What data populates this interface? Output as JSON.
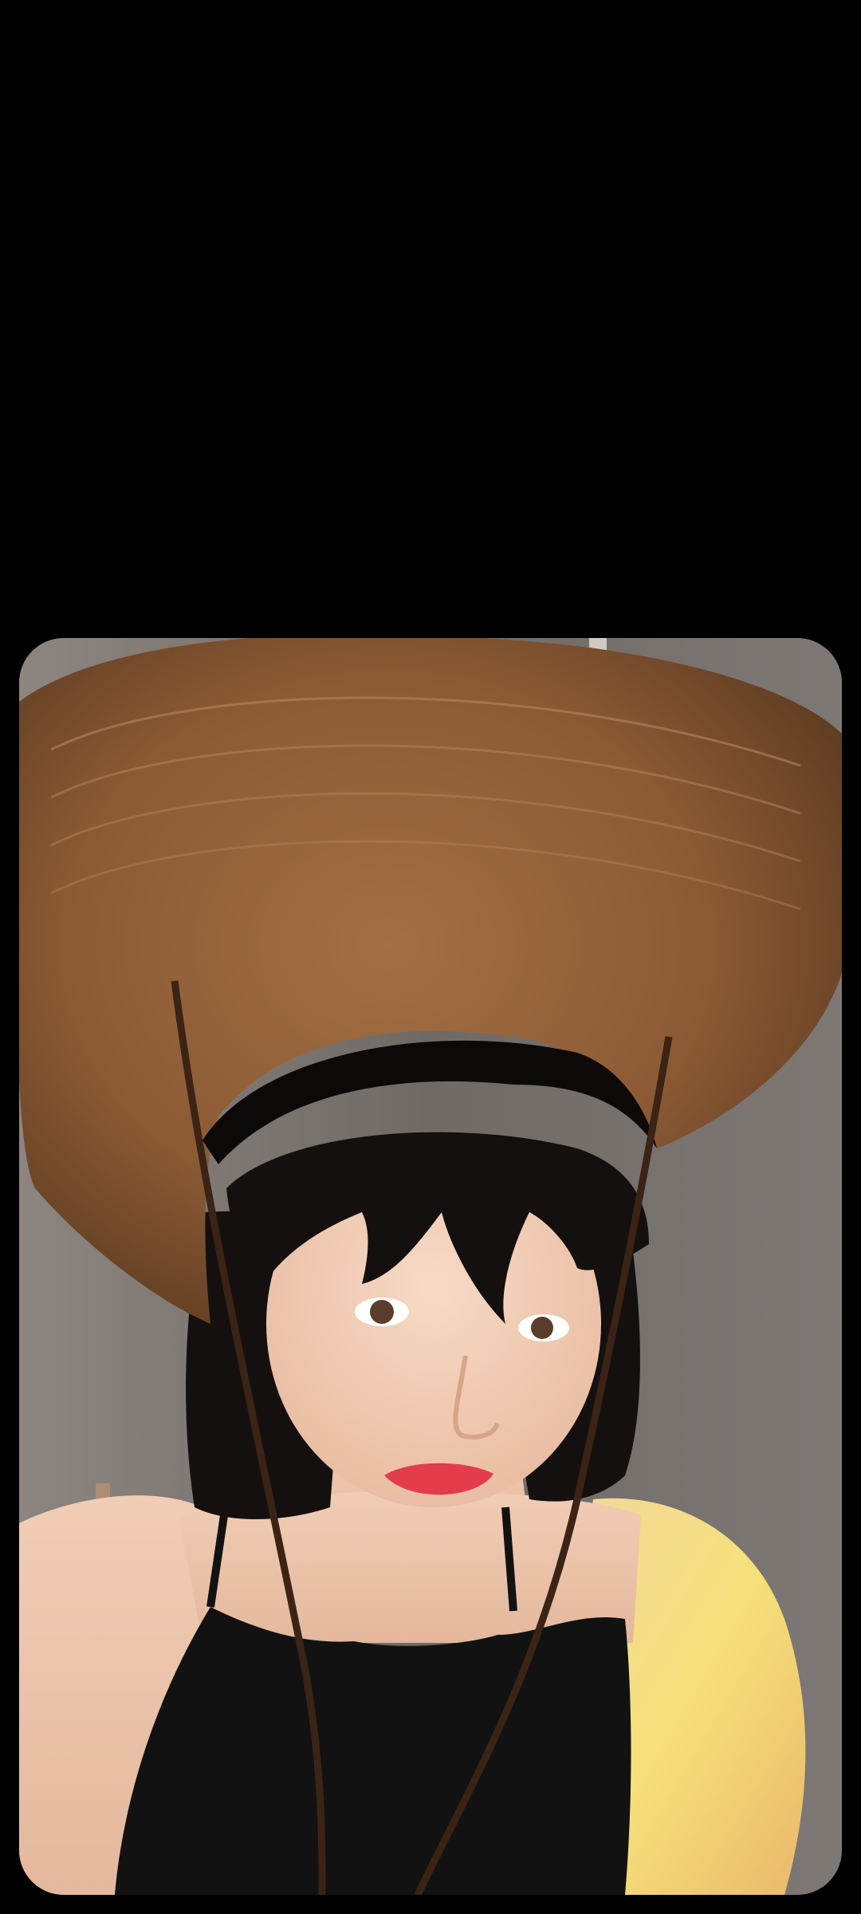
{
  "screen": {
    "background": "#000000"
  },
  "photo": {
    "subject": "portrait-photo",
    "colors": {
      "hat": "#8b5a34",
      "hat_shadow": "#5c3a21",
      "hair": "#14100f",
      "skin": "#f0cdb5",
      "skin_warm": "#f4d37b",
      "lips": "#e23c4d",
      "top": "#121212",
      "wall": "#6f6a66"
    }
  }
}
